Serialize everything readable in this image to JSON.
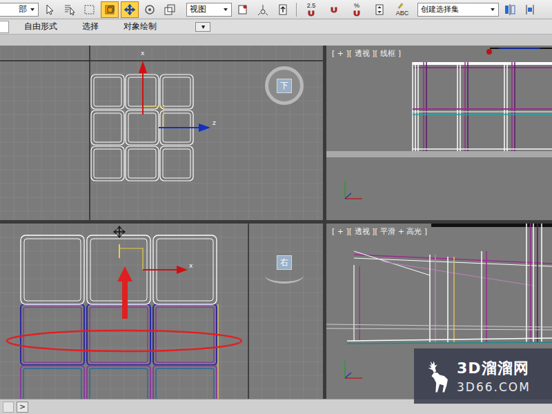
{
  "toolbar": {
    "filter_dropdown": "部",
    "select_tools": [
      {
        "selected": false
      },
      {
        "selected": false
      },
      {
        "selected": false
      },
      {
        "selected": true
      },
      {
        "selected": true
      },
      {
        "selected": false
      },
      {
        "selected": false
      }
    ],
    "reference_dropdown": "视图",
    "pivot_tools": [
      {
        "selected": false
      },
      {
        "selected": false
      },
      {
        "selected": false
      }
    ],
    "snap_tools": [
      {
        "text": "2.5",
        "selected": false
      },
      {
        "text": "",
        "selected": false
      },
      {
        "text": "%",
        "selected": false
      },
      {
        "text": "",
        "selected": false
      },
      {
        "text": "ABC",
        "selected": false
      }
    ],
    "selection_set_dropdown": "创建选择集",
    "end_tools": [
      {
        "selected": false
      },
      {
        "selected": false
      }
    ]
  },
  "ribbon": {
    "tabs": [
      {
        "label": "自由形式",
        "selected": false
      },
      {
        "label": "选择",
        "selected": false
      },
      {
        "label": "对象绘制",
        "selected": false
      }
    ],
    "menu_button": "▾"
  },
  "viewports": [
    {
      "kind": "top",
      "label": "",
      "active": false,
      "viewcube": "下",
      "axis_labels": [
        "x",
        "z"
      ]
    },
    {
      "kind": "persp-wire",
      "label": "[ + ][ 透视 ][ 线框 ]",
      "active": false,
      "viewcube": "",
      "axis_labels": []
    },
    {
      "kind": "side",
      "label": "",
      "active": true,
      "viewcube": "右",
      "axis_labels": [
        "x"
      ]
    },
    {
      "kind": "persp-shaded",
      "label": "[ + ][ 透视 ][ 平滑 + 高光 ]",
      "active": false,
      "viewcube": "",
      "axis_labels": []
    }
  ],
  "timeline": {
    "button": ">"
  },
  "watermark": {
    "name": "3D溜溜网",
    "url": "3D66.COM"
  }
}
